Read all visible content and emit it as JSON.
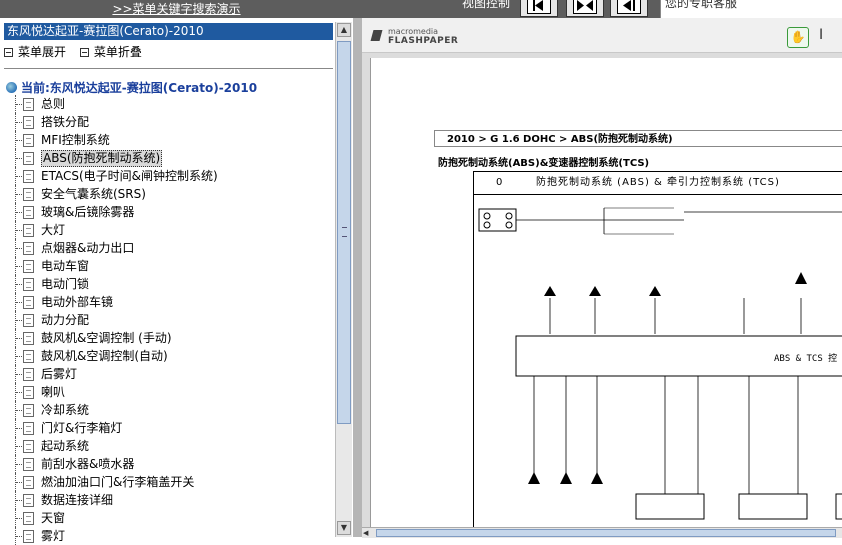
{
  "topbar": {
    "search_link": ">>菜单关键字搜索演示",
    "view_label": "视图控制",
    "help_text": "您的专职客服"
  },
  "left_panel": {
    "title": "东风悦达起亚-赛拉图(Cerato)-2010",
    "expand_menu": "菜单展开",
    "collapse_menu": "菜单折叠",
    "current": "当前:东风悦达起亚-赛拉图(Cerato)-2010",
    "items": [
      "总则",
      "搭铁分配",
      "MFI控制系统",
      "ABS(防抱死制动系统)",
      "ETACS(电子时间&闸钟控制系统)",
      "安全气囊系统(SRS)",
      "玻璃&后镜除雾器",
      "大灯",
      "点烟器&动力出口",
      "电动车窗",
      "电动门锁",
      "电动外部车镜",
      "动力分配",
      "鼓风机&空调控制 (手动)",
      "鼓风机&空调控制(自动)",
      "后雾灯",
      "喇叭",
      "冷却系统",
      "门灯&行李箱灯",
      "起动系统",
      "前刮水器&喷水器",
      "燃油加油口门&行李箱盖开关",
      "数据连接详细",
      "天窗",
      "雾灯"
    ],
    "selected_index": 3
  },
  "viewer": {
    "logo_top": "macromedia",
    "logo_bottom": "FLASHPAPER",
    "page_header": "2010 > G 1.6 DOHC > ABS(防抱死制动系统)",
    "page_subtitle": "防抱死制动系统(ABS)&变速器控制系统(TCS)",
    "diagram_number": "0",
    "diagram_title": "防抱死制动系统 (ABS) & 牵引力控制系统 (TCS)",
    "module_label": "ABS & TCS 控"
  }
}
